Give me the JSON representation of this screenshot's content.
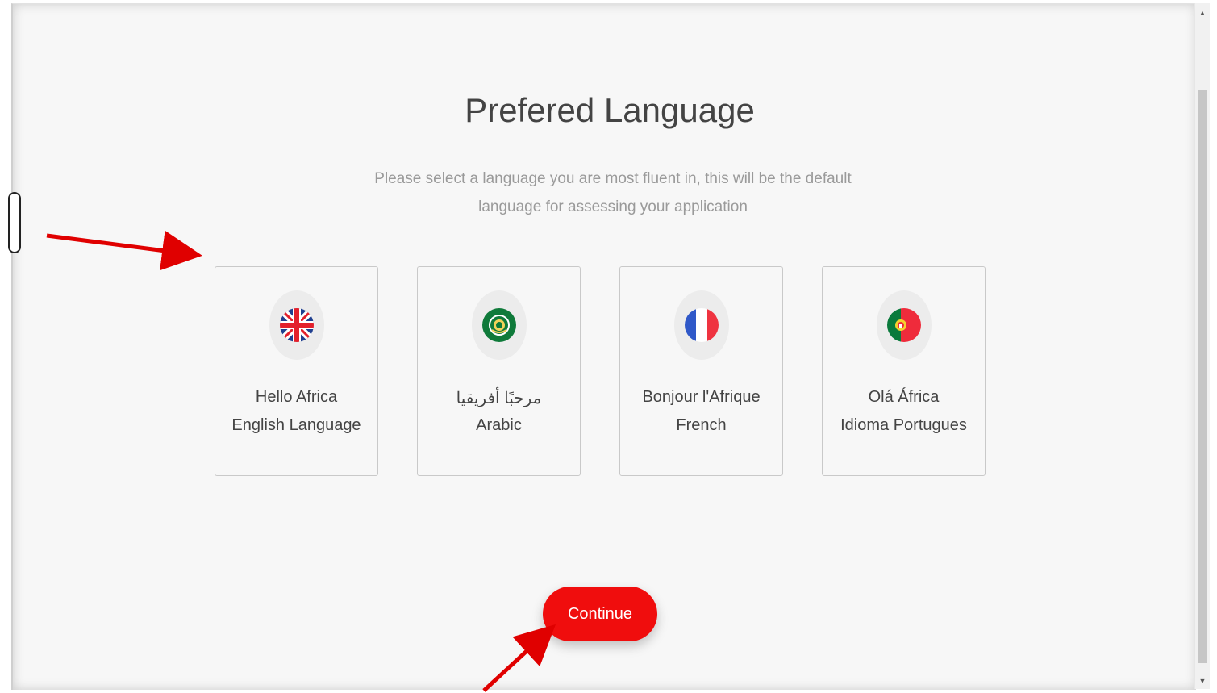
{
  "page": {
    "title": "Prefered Language",
    "subtitle_line1": "Please select a language you are most fluent in, this will be the default",
    "subtitle_line2": "language for assessing your application"
  },
  "languages": [
    {
      "greeting": "Hello Africa",
      "name": "English Language",
      "flag_icon": "uk-flag-icon"
    },
    {
      "greeting": "مرحبًا أفريقيا",
      "name": "Arabic",
      "flag_icon": "arab-league-flag-icon"
    },
    {
      "greeting": "Bonjour l'Afrique",
      "name": "French",
      "flag_icon": "france-flag-icon"
    },
    {
      "greeting": "Olá África",
      "name": "Idioma Portugues",
      "flag_icon": "portugal-flag-icon"
    }
  ],
  "actions": {
    "continue_label": "Continue"
  },
  "colors": {
    "accent": "#f00d0d",
    "annotation_arrow": "#e00000"
  }
}
